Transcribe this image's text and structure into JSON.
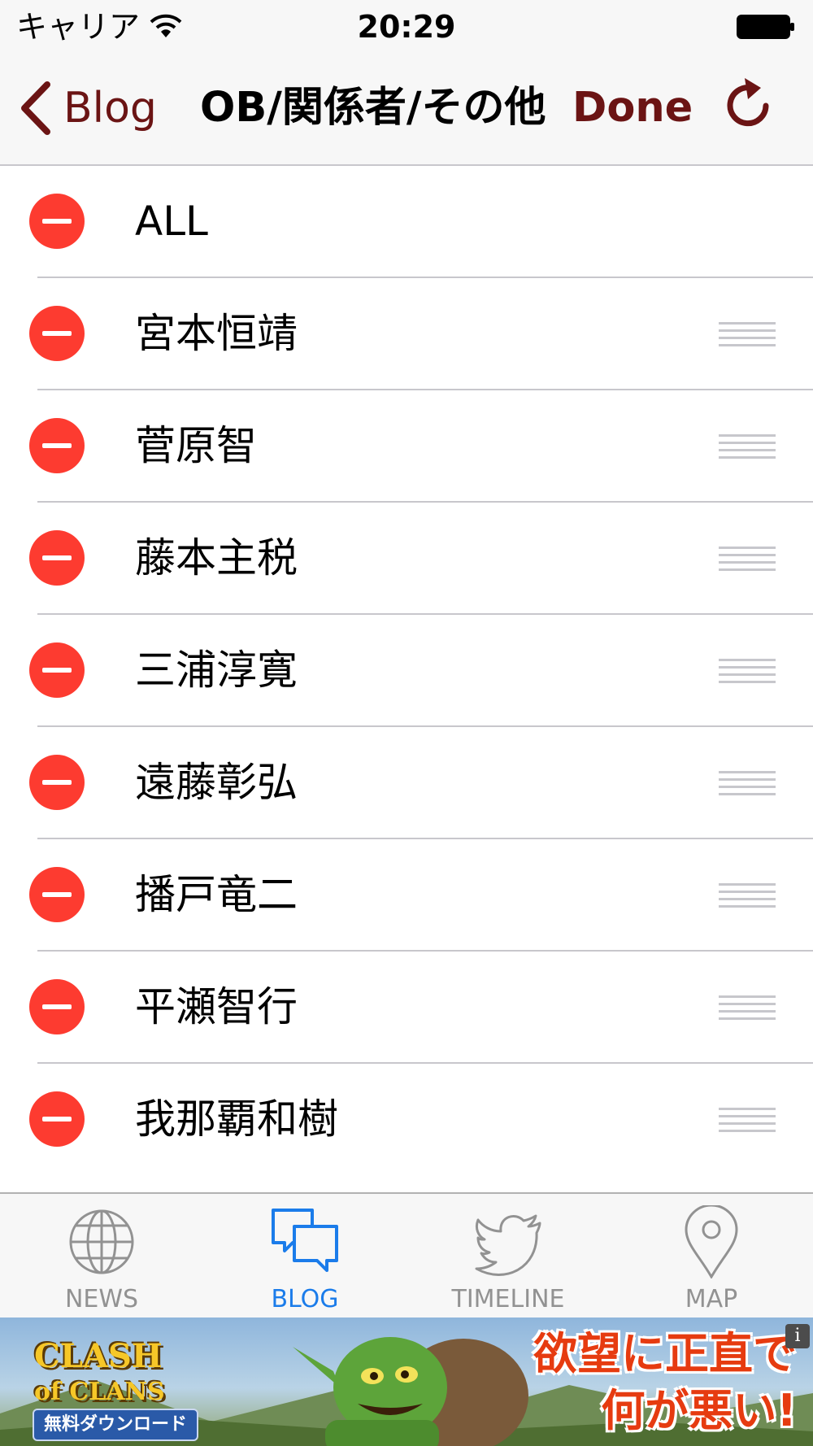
{
  "status_bar": {
    "carrier": "キャリア",
    "time": "20:29"
  },
  "nav": {
    "back_label": "Blog",
    "title": "OB/関係者/その他",
    "done_label": "Done",
    "accent_color": "#6b1414"
  },
  "list": {
    "items": [
      {
        "label": "ALL",
        "reorderable": false
      },
      {
        "label": "宮本恒靖",
        "reorderable": true
      },
      {
        "label": "菅原智",
        "reorderable": true
      },
      {
        "label": "藤本主税",
        "reorderable": true
      },
      {
        "label": "三浦淳寛",
        "reorderable": true
      },
      {
        "label": "遠藤彰弘",
        "reorderable": true
      },
      {
        "label": "播戸竜二",
        "reorderable": true
      },
      {
        "label": "平瀬智行",
        "reorderable": true
      },
      {
        "label": "我那覇和樹",
        "reorderable": true
      }
    ],
    "delete_color": "#fd3b30"
  },
  "tabbar": {
    "tabs": [
      {
        "label": "NEWS",
        "icon": "globe-icon",
        "active": false
      },
      {
        "label": "BLOG",
        "icon": "chat-bubbles-icon",
        "active": true
      },
      {
        "label": "TIMELINE",
        "icon": "bird-icon",
        "active": false
      },
      {
        "label": "MAP",
        "icon": "map-pin-icon",
        "active": false
      }
    ],
    "active_color": "#1b7cea",
    "inactive_color": "#929292"
  },
  "ad": {
    "logo_line1": "CLASH",
    "logo_line2": "of CLANS",
    "download_label": "無料ダウンロード",
    "copy_line1": "欲望に正直で",
    "copy_line2": "何が悪い!",
    "info_glyph": "i"
  }
}
